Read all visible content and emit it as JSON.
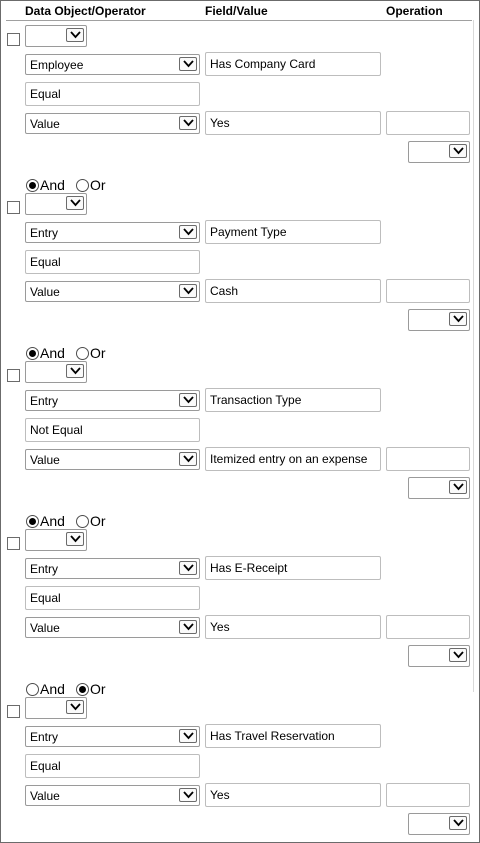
{
  "header": {
    "data_object_operator": "Data Object/Operator",
    "field_value": "Field/Value",
    "operation": "Operation"
  },
  "conditions": [
    {
      "object": "Employee",
      "field": "Has Company Card",
      "operator": "Equal",
      "value_type": "Value",
      "value": "Yes"
    },
    {
      "connector": "And",
      "object": "Entry",
      "field": "Payment Type",
      "operator": "Equal",
      "value_type": "Value",
      "value": "Cash"
    },
    {
      "connector": "And",
      "object": "Entry",
      "field": "Transaction Type",
      "operator": "Not Equal",
      "value_type": "Value",
      "value": "Itemized entry on an expense"
    },
    {
      "connector": "And",
      "object": "Entry",
      "field": "Has E-Receipt",
      "operator": "Equal",
      "value_type": "Value",
      "value": "Yes"
    },
    {
      "connector": "Or",
      "object": "Entry",
      "field": "Has Travel Reservation",
      "operator": "Equal",
      "value_type": "Value",
      "value": "Yes"
    }
  ],
  "connector_labels": {
    "and": "And",
    "or": "Or"
  }
}
